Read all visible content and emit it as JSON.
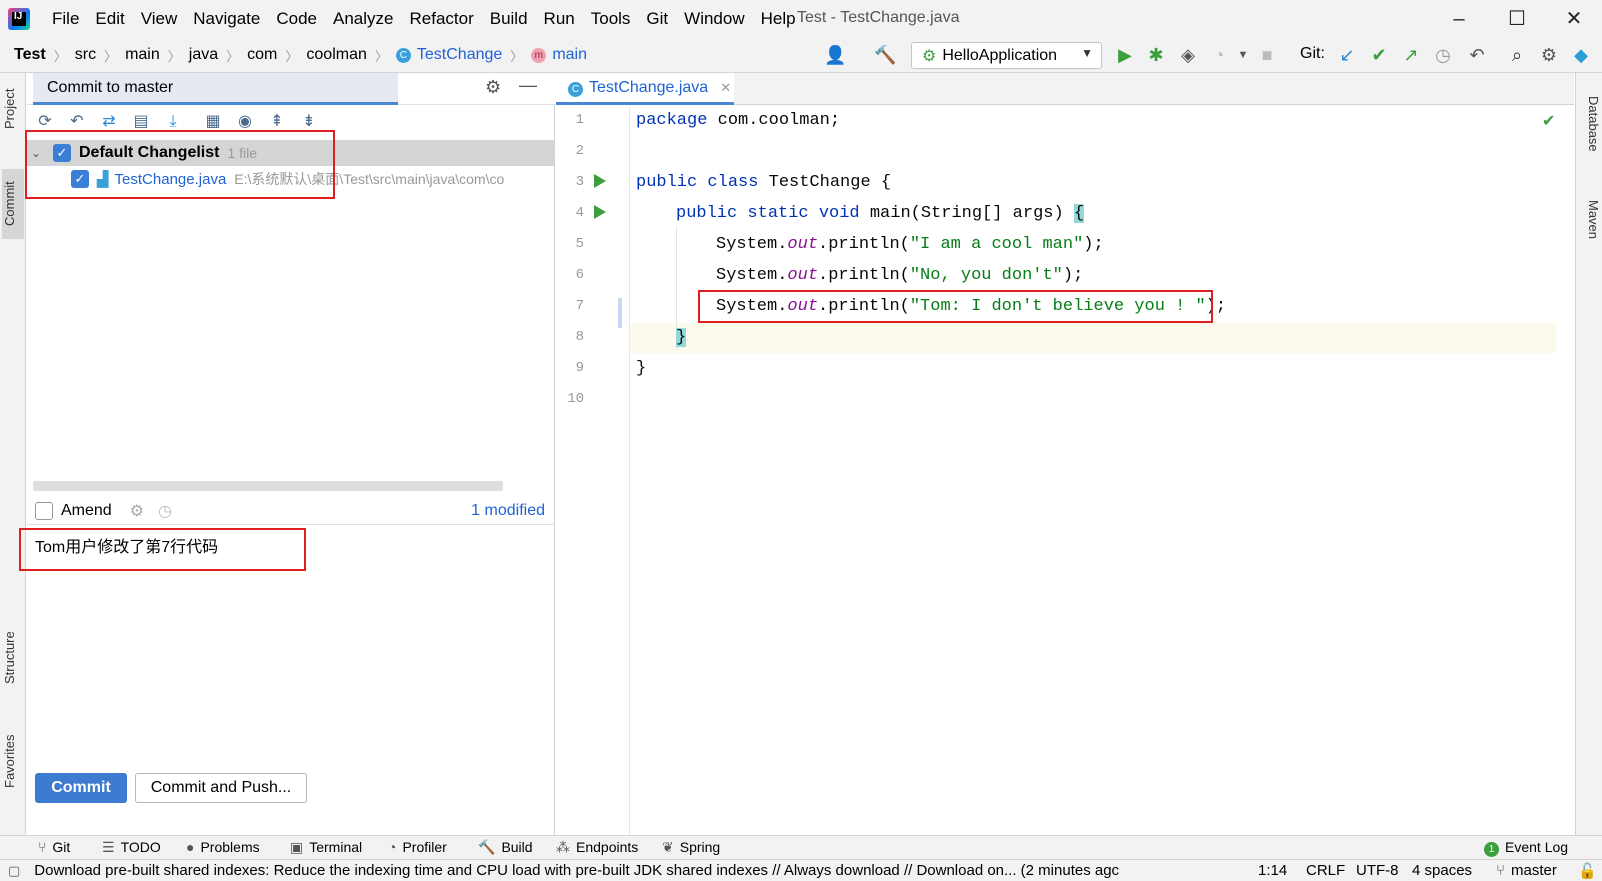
{
  "menubar": {
    "items": [
      "File",
      "Edit",
      "View",
      "Navigate",
      "Code",
      "Analyze",
      "Refactor",
      "Build",
      "Run",
      "Tools",
      "Git",
      "Window",
      "Help"
    ],
    "window_title": "Test - TestChange.java"
  },
  "navbar": {
    "crumbs": [
      "Test",
      "src",
      "main",
      "java",
      "com",
      "coolman",
      "TestChange",
      "main"
    ],
    "run_config": "HelloApplication",
    "git_label": "Git:"
  },
  "left_strip": {
    "project": "Project",
    "commit": "Commit",
    "structure": "Structure",
    "favorites": "Favorites"
  },
  "right_strip": {
    "database": "Database",
    "maven": "Maven"
  },
  "commit_panel": {
    "title": "Commit to master",
    "changelist_name": "Default Changelist",
    "changelist_count": "1 file",
    "file_name": "TestChange.java",
    "file_path": "E:\\系统默认\\桌面\\Test\\src\\main\\java\\com\\co",
    "amend_label": "Amend",
    "modified_count": "1 modified",
    "message": "Tom用户修改了第7行代码",
    "commit_button": "Commit",
    "commit_push_button": "Commit and Push..."
  },
  "editor": {
    "tab_label": "TestChange.java",
    "line_numbers": [
      "1",
      "2",
      "3",
      "4",
      "5",
      "6",
      "7",
      "8",
      "9",
      "10"
    ],
    "lines": {
      "l1_kw": "package",
      "l1_rest": " com.coolman;",
      "l3_kw": "public class",
      "l3_rest": " TestChange {",
      "l4_kw": "public static void",
      "l4_rest": " main(String[] args) ",
      "l4_brace": "{",
      "l5_a": "System.",
      "l5_f": "out",
      "l5_b": ".println(",
      "l5_s": "\"I am a cool man\"",
      "l5_c": ");",
      "l6_a": "System.",
      "l6_f": "out",
      "l6_b": ".println(",
      "l6_s": "\"No, you don't\"",
      "l6_c": ");",
      "l7_a": "System.",
      "l7_f": "out",
      "l7_b": ".println(",
      "l7_s": "\"Tom: I don't believe you ! \"",
      "l7_c": ");",
      "l8_brace": "}",
      "l9_brace": "}"
    }
  },
  "bottom_tools": [
    "Git",
    "TODO",
    "Problems",
    "Terminal",
    "Profiler",
    "Build",
    "Endpoints",
    "Spring"
  ],
  "event_log": "Event Log",
  "event_log_count": "1",
  "statusbar": {
    "message": "Download pre-built shared indexes: Reduce the indexing time and CPU load with pre-built JDK shared indexes // Always download // Download on... (2 minutes agc",
    "position": "1:14",
    "line_sep": "CRLF",
    "encoding": "UTF-8",
    "indent": "4 spaces",
    "branch": "master"
  },
  "colors": {
    "accent": "#3d7bd0",
    "highlight_box": "#e02020",
    "keyword": "#0033b3",
    "string": "#067d17",
    "field": "#871094"
  }
}
